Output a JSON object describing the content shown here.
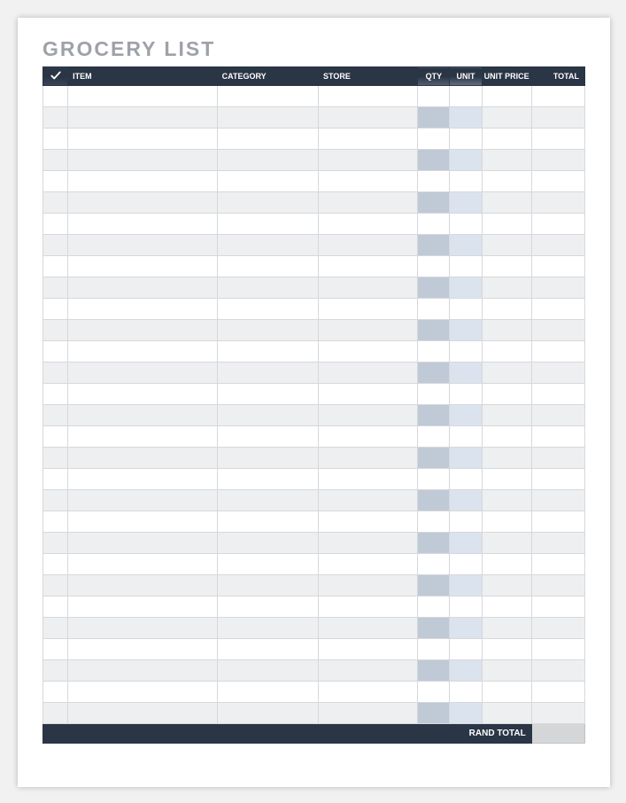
{
  "title": "GROCERY LIST",
  "columns": {
    "check": "",
    "item": "ITEM",
    "category": "CATEGORY",
    "store": "STORE",
    "qty": "QTY",
    "unit": "UNIT",
    "unit_price": "UNIT PRICE",
    "total": "TOTAL"
  },
  "row_count": 30,
  "rows": [
    {
      "check": "",
      "item": "",
      "category": "",
      "store": "",
      "qty": "",
      "unit": "",
      "unit_price": "",
      "total": ""
    },
    {
      "check": "",
      "item": "",
      "category": "",
      "store": "",
      "qty": "",
      "unit": "",
      "unit_price": "",
      "total": ""
    },
    {
      "check": "",
      "item": "",
      "category": "",
      "store": "",
      "qty": "",
      "unit": "",
      "unit_price": "",
      "total": ""
    },
    {
      "check": "",
      "item": "",
      "category": "",
      "store": "",
      "qty": "",
      "unit": "",
      "unit_price": "",
      "total": ""
    },
    {
      "check": "",
      "item": "",
      "category": "",
      "store": "",
      "qty": "",
      "unit": "",
      "unit_price": "",
      "total": ""
    },
    {
      "check": "",
      "item": "",
      "category": "",
      "store": "",
      "qty": "",
      "unit": "",
      "unit_price": "",
      "total": ""
    },
    {
      "check": "",
      "item": "",
      "category": "",
      "store": "",
      "qty": "",
      "unit": "",
      "unit_price": "",
      "total": ""
    },
    {
      "check": "",
      "item": "",
      "category": "",
      "store": "",
      "qty": "",
      "unit": "",
      "unit_price": "",
      "total": ""
    },
    {
      "check": "",
      "item": "",
      "category": "",
      "store": "",
      "qty": "",
      "unit": "",
      "unit_price": "",
      "total": ""
    },
    {
      "check": "",
      "item": "",
      "category": "",
      "store": "",
      "qty": "",
      "unit": "",
      "unit_price": "",
      "total": ""
    },
    {
      "check": "",
      "item": "",
      "category": "",
      "store": "",
      "qty": "",
      "unit": "",
      "unit_price": "",
      "total": ""
    },
    {
      "check": "",
      "item": "",
      "category": "",
      "store": "",
      "qty": "",
      "unit": "",
      "unit_price": "",
      "total": ""
    },
    {
      "check": "",
      "item": "",
      "category": "",
      "store": "",
      "qty": "",
      "unit": "",
      "unit_price": "",
      "total": ""
    },
    {
      "check": "",
      "item": "",
      "category": "",
      "store": "",
      "qty": "",
      "unit": "",
      "unit_price": "",
      "total": ""
    },
    {
      "check": "",
      "item": "",
      "category": "",
      "store": "",
      "qty": "",
      "unit": "",
      "unit_price": "",
      "total": ""
    },
    {
      "check": "",
      "item": "",
      "category": "",
      "store": "",
      "qty": "",
      "unit": "",
      "unit_price": "",
      "total": ""
    },
    {
      "check": "",
      "item": "",
      "category": "",
      "store": "",
      "qty": "",
      "unit": "",
      "unit_price": "",
      "total": ""
    },
    {
      "check": "",
      "item": "",
      "category": "",
      "store": "",
      "qty": "",
      "unit": "",
      "unit_price": "",
      "total": ""
    },
    {
      "check": "",
      "item": "",
      "category": "",
      "store": "",
      "qty": "",
      "unit": "",
      "unit_price": "",
      "total": ""
    },
    {
      "check": "",
      "item": "",
      "category": "",
      "store": "",
      "qty": "",
      "unit": "",
      "unit_price": "",
      "total": ""
    },
    {
      "check": "",
      "item": "",
      "category": "",
      "store": "",
      "qty": "",
      "unit": "",
      "unit_price": "",
      "total": ""
    },
    {
      "check": "",
      "item": "",
      "category": "",
      "store": "",
      "qty": "",
      "unit": "",
      "unit_price": "",
      "total": ""
    },
    {
      "check": "",
      "item": "",
      "category": "",
      "store": "",
      "qty": "",
      "unit": "",
      "unit_price": "",
      "total": ""
    },
    {
      "check": "",
      "item": "",
      "category": "",
      "store": "",
      "qty": "",
      "unit": "",
      "unit_price": "",
      "total": ""
    },
    {
      "check": "",
      "item": "",
      "category": "",
      "store": "",
      "qty": "",
      "unit": "",
      "unit_price": "",
      "total": ""
    },
    {
      "check": "",
      "item": "",
      "category": "",
      "store": "",
      "qty": "",
      "unit": "",
      "unit_price": "",
      "total": ""
    },
    {
      "check": "",
      "item": "",
      "category": "",
      "store": "",
      "qty": "",
      "unit": "",
      "unit_price": "",
      "total": ""
    },
    {
      "check": "",
      "item": "",
      "category": "",
      "store": "",
      "qty": "",
      "unit": "",
      "unit_price": "",
      "total": ""
    },
    {
      "check": "",
      "item": "",
      "category": "",
      "store": "",
      "qty": "",
      "unit": "",
      "unit_price": "",
      "total": ""
    },
    {
      "check": "",
      "item": "",
      "category": "",
      "store": "",
      "qty": "",
      "unit": "",
      "unit_price": "",
      "total": ""
    }
  ],
  "footer": {
    "label": "RAND TOTAL",
    "value": ""
  }
}
